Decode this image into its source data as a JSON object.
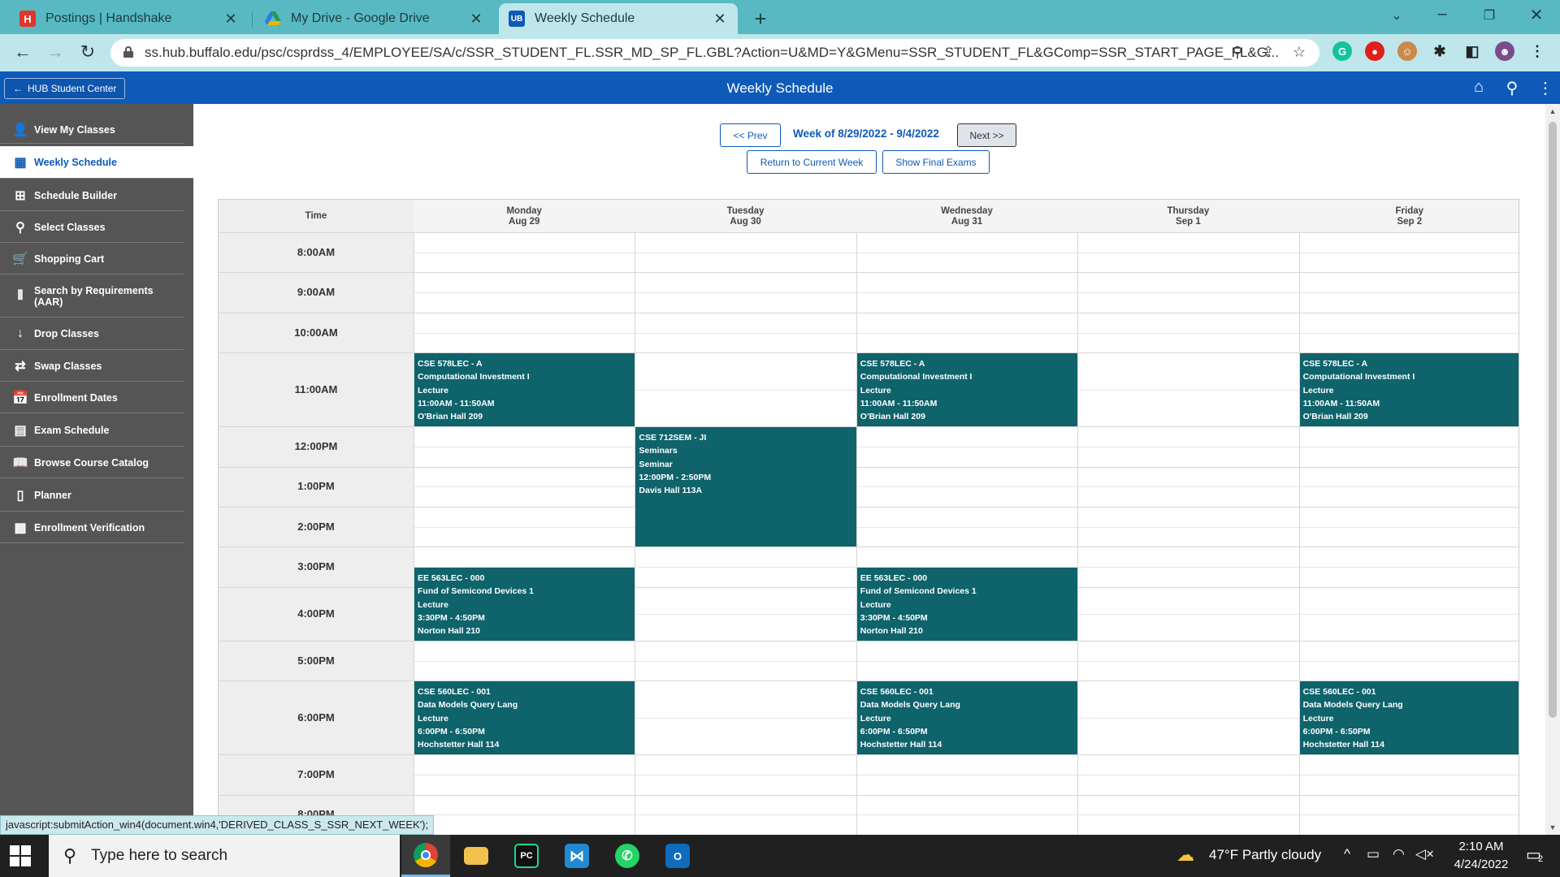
{
  "browser": {
    "tabs": [
      {
        "title": "Postings | Handshake",
        "favicon": "handshake-icon",
        "favicon_letter": "H",
        "color": "#e0352b"
      },
      {
        "title": "My Drive - Google Drive",
        "favicon": "google-drive-icon",
        "color": "#f2b200"
      },
      {
        "title": "Weekly Schedule",
        "favicon": "ub-icon",
        "color": "#0e5ab8"
      }
    ],
    "url": "ss.hub.buffalo.edu/psc/csprdss_4/EMPLOYEE/SA/c/SSR_STUDENT_FL.SSR_MD_SP_FL.GBL?Action=U&MD=Y&GMenu=SSR_STUDENT_FL&GComp=SSR_START_PAGE_FL&G..."
  },
  "app": {
    "back_label": "HUB Student Center",
    "title": "Weekly Schedule"
  },
  "sidebar": {
    "items": [
      {
        "label": "View My Classes",
        "icon": "person-icon"
      },
      {
        "label": "Weekly Schedule",
        "icon": "calendar-icon",
        "active": true
      },
      {
        "label": "Schedule Builder",
        "icon": "blocks-icon"
      },
      {
        "label": "Select Classes",
        "icon": "search-icon"
      },
      {
        "label": "Shopping Cart",
        "icon": "cart-icon"
      },
      {
        "label": "Search by Requirements (AAR)",
        "icon": "requirements-icon"
      },
      {
        "label": "Drop Classes",
        "icon": "drop-icon"
      },
      {
        "label": "Swap Classes",
        "icon": "swap-icon"
      },
      {
        "label": "Enrollment Dates",
        "icon": "calendar-12-icon"
      },
      {
        "label": "Exam Schedule",
        "icon": "exam-icon"
      },
      {
        "label": "Browse Course Catalog",
        "icon": "book-icon"
      },
      {
        "label": "Planner",
        "icon": "planner-icon"
      },
      {
        "label": "Enrollment Verification",
        "icon": "verification-icon"
      }
    ]
  },
  "schedule": {
    "prev_label": "<< Prev",
    "next_label": "Next >>",
    "week_label": "Week of 8/29/2022 - 9/4/2022",
    "return_label": "Return to Current Week",
    "final_exams_label": "Show Final Exams",
    "time_header": "Time",
    "days": [
      {
        "name": "Monday",
        "date": "Aug 29"
      },
      {
        "name": "Tuesday",
        "date": "Aug 30"
      },
      {
        "name": "Wednesday",
        "date": "Aug 31"
      },
      {
        "name": "Thursday",
        "date": "Sep 1"
      },
      {
        "name": "Friday",
        "date": "Sep 2"
      }
    ],
    "times": [
      "8:00AM",
      "9:00AM",
      "10:00AM",
      "11:00AM",
      "12:00PM",
      "1:00PM",
      "2:00PM",
      "3:00PM",
      "4:00PM",
      "5:00PM",
      "6:00PM",
      "7:00PM",
      "8:00PM"
    ],
    "events": [
      {
        "day": 0,
        "start": "11:00",
        "end": "12:00",
        "lines": [
          "CSE 578LEC - A",
          "Computational Investment I",
          "Lecture",
          "11:00AM - 11:50AM",
          "O'Brian Hall 209"
        ]
      },
      {
        "day": 2,
        "start": "11:00",
        "end": "12:00",
        "lines": [
          "CSE 578LEC - A",
          "Computational Investment I",
          "Lecture",
          "11:00AM - 11:50AM",
          "O'Brian Hall 209"
        ]
      },
      {
        "day": 4,
        "start": "11:00",
        "end": "12:00",
        "lines": [
          "CSE 578LEC - A",
          "Computational Investment I",
          "Lecture",
          "11:00AM - 11:50AM",
          "O'Brian Hall 209"
        ]
      },
      {
        "day": 1,
        "start": "12:00",
        "end": "15:00",
        "lines": [
          "CSE 712SEM - JI",
          "Seminars",
          "Seminar",
          "12:00PM - 2:50PM",
          "Davis Hall 113A"
        ]
      },
      {
        "day": 0,
        "start": "15:30",
        "end": "17:00",
        "lines": [
          "EE 563LEC - 000",
          "Fund of Semicond Devices 1",
          "Lecture",
          "3:30PM - 4:50PM",
          "Norton Hall 210"
        ]
      },
      {
        "day": 2,
        "start": "15:30",
        "end": "17:00",
        "lines": [
          "EE 563LEC - 000",
          "Fund of Semicond Devices 1",
          "Lecture",
          "3:30PM - 4:50PM",
          "Norton Hall 210"
        ]
      },
      {
        "day": 0,
        "start": "18:00",
        "end": "19:00",
        "lines": [
          "CSE 560LEC - 001",
          "Data Models Query Lang",
          "Lecture",
          "6:00PM - 6:50PM",
          "Hochstetter Hall 114"
        ]
      },
      {
        "day": 2,
        "start": "18:00",
        "end": "19:00",
        "lines": [
          "CSE 560LEC - 001",
          "Data Models Query Lang",
          "Lecture",
          "6:00PM - 6:50PM",
          "Hochstetter Hall 114"
        ]
      },
      {
        "day": 4,
        "start": "18:00",
        "end": "19:00",
        "lines": [
          "CSE 560LEC - 001",
          "Data Models Query Lang",
          "Lecture",
          "6:00PM - 6:50PM",
          "Hochstetter Hall 114"
        ]
      }
    ],
    "event_color": "#0f636b"
  },
  "status_bar": "javascript:submitAction_win4(document.win4,'DERIVED_CLASS_S_SSR_NEXT_WEEK');",
  "taskbar": {
    "search_placeholder": "Type here to search",
    "weather": "47°F  Partly cloudy",
    "time": "2:10 AM",
    "date": "4/24/2022",
    "notifications": "2"
  }
}
